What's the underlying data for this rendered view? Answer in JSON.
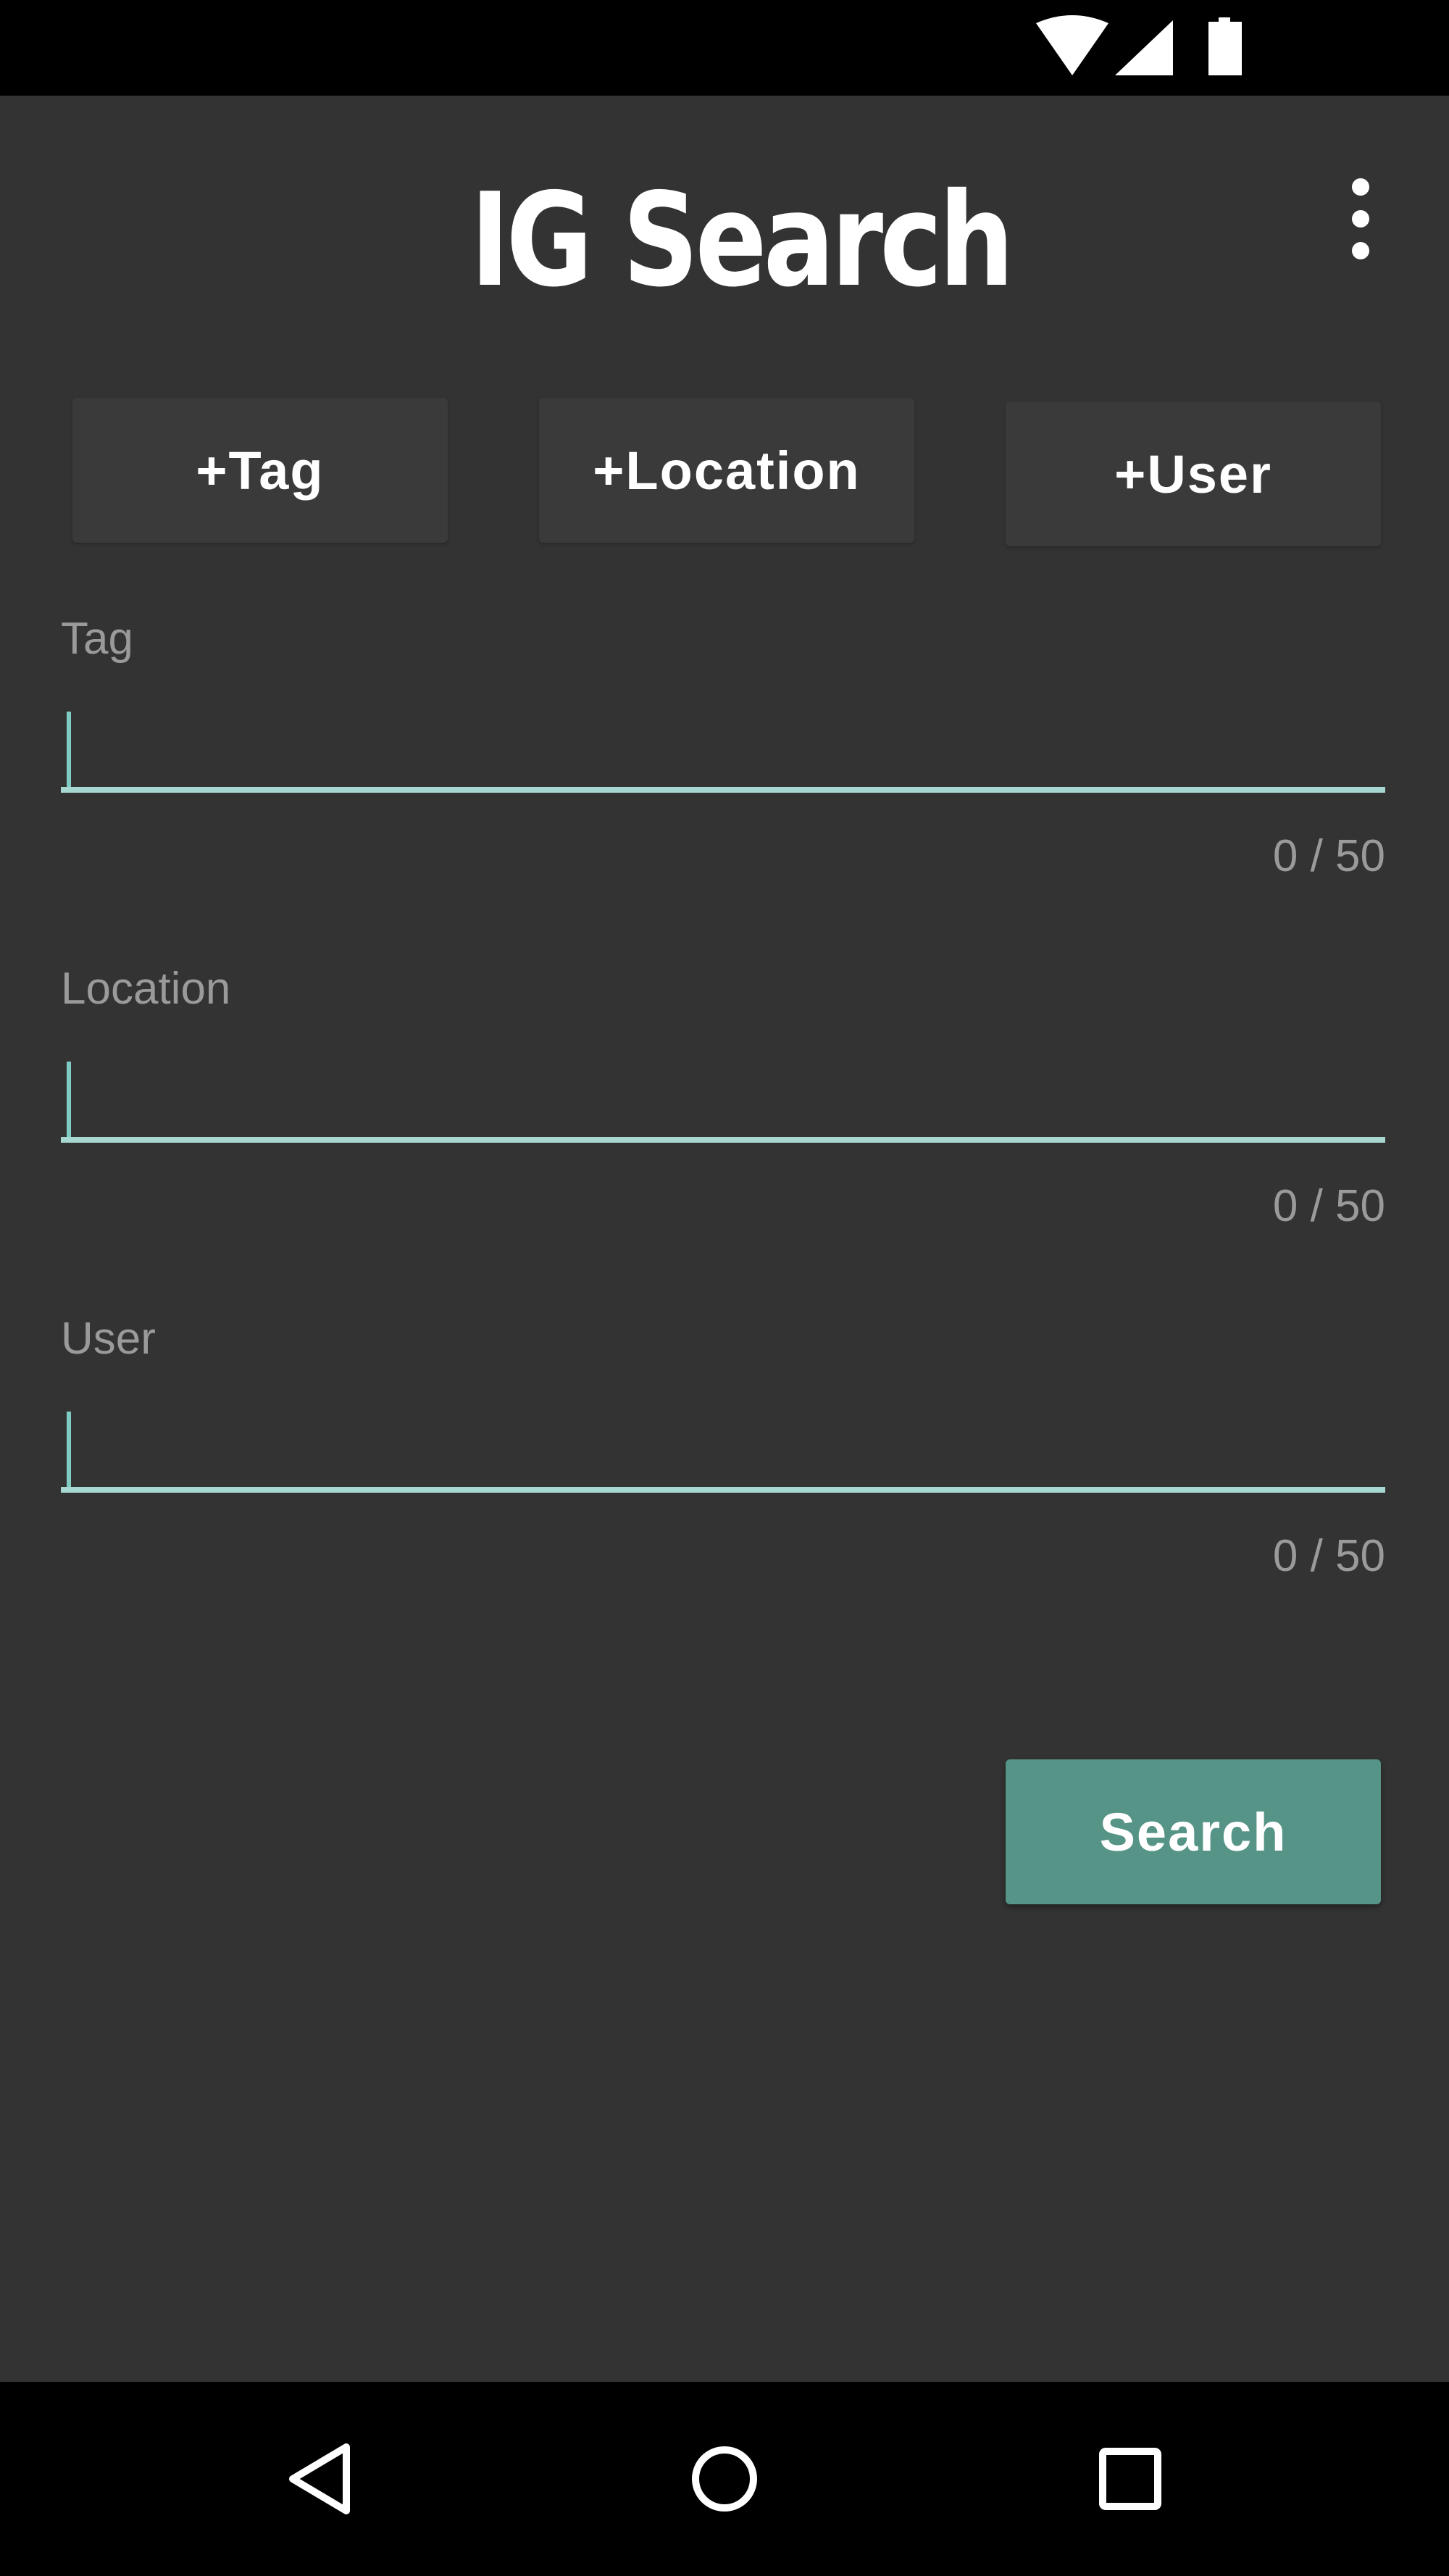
{
  "status_bar": {
    "icons": [
      "wifi-icon",
      "signal-icon",
      "battery-icon"
    ]
  },
  "app": {
    "title": "IG Search",
    "menu_icon": "more-vert-icon"
  },
  "chips": {
    "tag": "+Tag",
    "location": "+Location",
    "user": "+User"
  },
  "fields": {
    "tag": {
      "label": "Tag",
      "value": "",
      "counter": "0 / 50"
    },
    "location": {
      "label": "Location",
      "value": "",
      "counter": "0 / 50"
    },
    "user": {
      "label": "User",
      "value": "",
      "counter": "0 / 50"
    }
  },
  "search_button": {
    "label": "Search"
  },
  "nav_bar": {
    "icons": [
      "back-icon",
      "home-icon",
      "recents-icon"
    ]
  },
  "colors": {
    "background": "#333333",
    "accent": "#80cbc4",
    "button": "#559486",
    "chip": "#3a3a3a",
    "hint_text": "#9a9a9a"
  }
}
